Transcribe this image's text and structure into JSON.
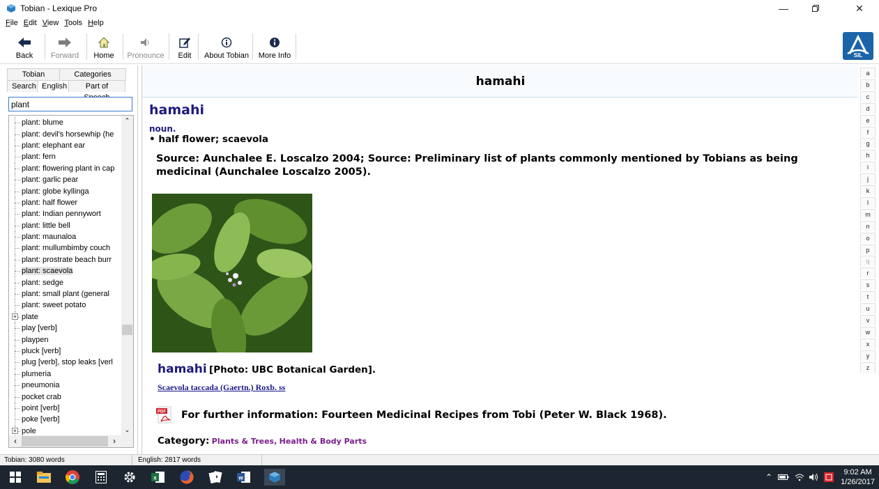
{
  "window": {
    "title": "Tobian - Lexique Pro"
  },
  "menu": [
    {
      "label": "File",
      "key": "F",
      "rest": "ile"
    },
    {
      "label": "Edit",
      "key": "E",
      "rest": "dit"
    },
    {
      "label": "View",
      "key": "V",
      "rest": "iew"
    },
    {
      "label": "Tools",
      "key": "T",
      "rest": "ools"
    },
    {
      "label": "Help",
      "key": "H",
      "rest": "elp"
    }
  ],
  "toolbar": {
    "back": "Back",
    "forward": "Forward",
    "home": "Home",
    "pronounce": "Pronounce",
    "edit": "Edit",
    "about": "About Tobian",
    "more_info": "More Info",
    "logo_text": "SIL"
  },
  "tabs": {
    "tobian": "Tobian",
    "categories": "Categories",
    "search": "Search",
    "english": "English",
    "part_of_speech": "Part of Speech"
  },
  "search": {
    "value": "plant"
  },
  "tree_items": [
    {
      "label": "plant: blume",
      "expandable": false,
      "selected": false
    },
    {
      "label": "plant: devil's horsewhip (he",
      "expandable": false,
      "selected": false
    },
    {
      "label": "plant: elephant ear",
      "expandable": false,
      "selected": false
    },
    {
      "label": "plant: fern",
      "expandable": false,
      "selected": false
    },
    {
      "label": "plant: flowering plant in cap",
      "expandable": false,
      "selected": false
    },
    {
      "label": "plant: garlic pear",
      "expandable": false,
      "selected": false
    },
    {
      "label": "plant: globe kyllinga",
      "expandable": false,
      "selected": false
    },
    {
      "label": "plant: half flower",
      "expandable": false,
      "selected": false
    },
    {
      "label": "plant: Indian pennywort",
      "expandable": false,
      "selected": false
    },
    {
      "label": "plant: little bell",
      "expandable": false,
      "selected": false
    },
    {
      "label": "plant: maunaloa",
      "expandable": false,
      "selected": false
    },
    {
      "label": "plant: mullumbimby couch",
      "expandable": false,
      "selected": false
    },
    {
      "label": "plant: prostrate beach burr",
      "expandable": false,
      "selected": false
    },
    {
      "label": "plant: scaevola",
      "expandable": false,
      "selected": true
    },
    {
      "label": "plant: sedge",
      "expandable": false,
      "selected": false
    },
    {
      "label": "plant: small plant (general",
      "expandable": false,
      "selected": false
    },
    {
      "label": "plant: sweet potato",
      "expandable": false,
      "selected": false
    },
    {
      "label": "plate",
      "expandable": true,
      "selected": false
    },
    {
      "label": "play [verb]",
      "expandable": false,
      "selected": false
    },
    {
      "label": "playpen",
      "expandable": false,
      "selected": false
    },
    {
      "label": "pluck [verb]",
      "expandable": false,
      "selected": false
    },
    {
      "label": "plug [verb], stop leaks [verl",
      "expandable": false,
      "selected": false
    },
    {
      "label": "plumeria",
      "expandable": false,
      "selected": false
    },
    {
      "label": "pneumonia",
      "expandable": false,
      "selected": false
    },
    {
      "label": "pocket crab",
      "expandable": false,
      "selected": false
    },
    {
      "label": "point [verb]",
      "expandable": false,
      "selected": false
    },
    {
      "label": "poke [verb]",
      "expandable": false,
      "selected": false
    },
    {
      "label": "pole",
      "expandable": true,
      "selected": false
    }
  ],
  "entry": {
    "header": "hamahi",
    "headword": "hamahi",
    "pos": "noun.",
    "gloss": "• half flower; scaevola",
    "source": "Source: Aunchalee E. Loscalzo 2004; Source: Preliminary list of plants commonly mentioned by Tobians as being medicinal (Aunchalee Loscalzo 2005).",
    "photo_word": "hamahi",
    "photo_caption": "[Photo: UBC Botanical Garden].",
    "latin_link": "Scaevola taccada (Gaertn.) Roxb. ss",
    "further_info": "For further information: Fourteen Medicinal Recipes from Tobi (Peter W. Black 1968).",
    "pdf_label": "PDF",
    "category_label": "Category:",
    "category_1": "Plants & Trees,",
    "category_2": "Health & Body Parts"
  },
  "alphabet": [
    {
      "l": "a",
      "dim": false
    },
    {
      "l": "b",
      "dim": false
    },
    {
      "l": "c",
      "dim": false
    },
    {
      "l": "d",
      "dim": false
    },
    {
      "l": "e",
      "dim": false
    },
    {
      "l": "f",
      "dim": false
    },
    {
      "l": "g",
      "dim": false
    },
    {
      "l": "h",
      "dim": false
    },
    {
      "l": "i",
      "dim": false
    },
    {
      "l": "j",
      "dim": false
    },
    {
      "l": "k",
      "dim": false
    },
    {
      "l": "l",
      "dim": false
    },
    {
      "l": "m",
      "dim": false
    },
    {
      "l": "n",
      "dim": false
    },
    {
      "l": "o",
      "dim": false
    },
    {
      "l": "p",
      "dim": false
    },
    {
      "l": "q",
      "dim": true
    },
    {
      "l": "r",
      "dim": false
    },
    {
      "l": "s",
      "dim": false
    },
    {
      "l": "t",
      "dim": false
    },
    {
      "l": "u",
      "dim": false
    },
    {
      "l": "v",
      "dim": false
    },
    {
      "l": "w",
      "dim": false
    },
    {
      "l": "x",
      "dim": false
    },
    {
      "l": "y",
      "dim": false
    },
    {
      "l": "z",
      "dim": false
    }
  ],
  "status": {
    "tobian_count": "Tobian: 3080 words",
    "english_count": "English: 2817 words"
  },
  "clock": {
    "time": "9:02 AM",
    "date": "1/26/2017"
  },
  "colors": {
    "headword": "#1d1a7e",
    "category_link": "#7a1f8a",
    "taskbar": "#1d2630",
    "logo": "#1b64a8"
  }
}
